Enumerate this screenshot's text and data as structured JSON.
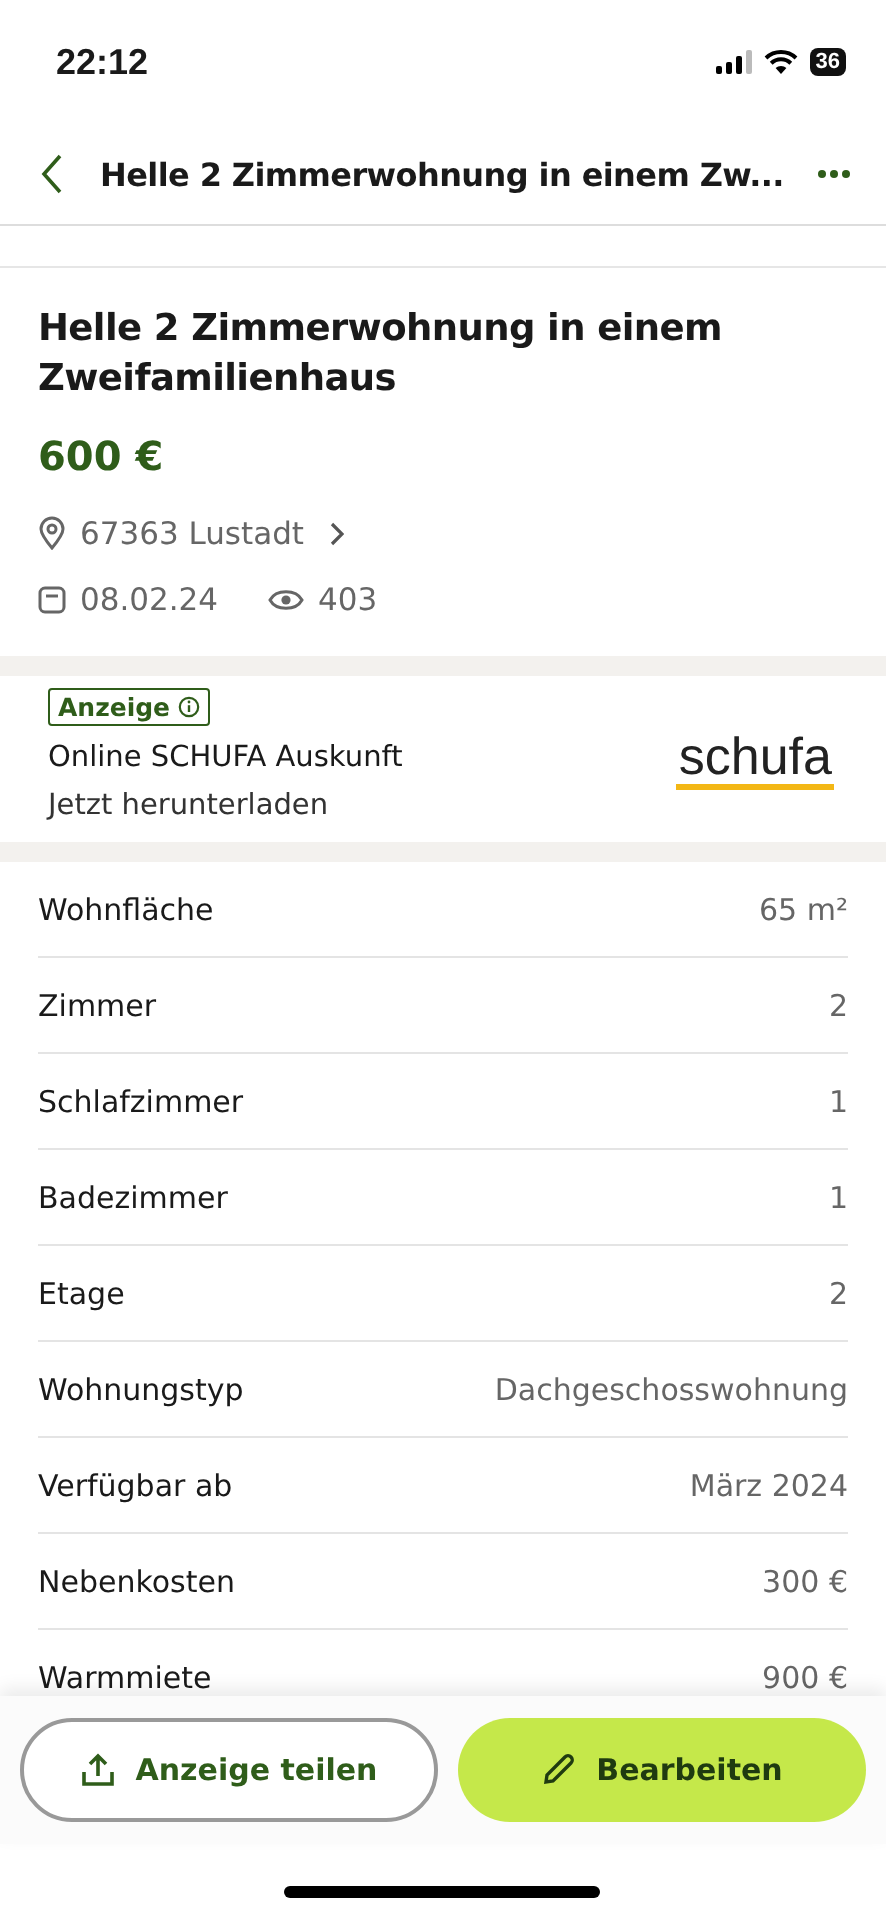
{
  "status_bar": {
    "time": "22:12",
    "battery": "36"
  },
  "header": {
    "title": "Helle 2 Zimmerwohnung in einem Zw..."
  },
  "listing": {
    "title": "Helle 2 Zimmerwohnung in einem Zweifamilienhaus",
    "price": "600 €",
    "location": "67363 Lustadt",
    "date": "08.02.24",
    "views": "403"
  },
  "ad": {
    "badge": "Anzeige",
    "title": "Online SCHUFA Auskunft",
    "subtitle": "Jetzt herunterladen",
    "logo": "schufa"
  },
  "details": [
    {
      "label": "Wohnfläche",
      "value": "65 m²"
    },
    {
      "label": "Zimmer",
      "value": "2"
    },
    {
      "label": "Schlafzimmer",
      "value": "1"
    },
    {
      "label": "Badezimmer",
      "value": "1"
    },
    {
      "label": "Etage",
      "value": "2"
    },
    {
      "label": "Wohnungstyp",
      "value": "Dachgeschosswohnung"
    },
    {
      "label": "Verfügbar ab",
      "value": "März 2024"
    },
    {
      "label": "Nebenkosten",
      "value": "300 €"
    },
    {
      "label": "Warmmiete",
      "value": "900 €"
    }
  ],
  "actions": [
    {
      "label": "Anzeige teilen",
      "kind": "share"
    },
    {
      "label": "Bearbeiten",
      "kind": "edit"
    }
  ]
}
